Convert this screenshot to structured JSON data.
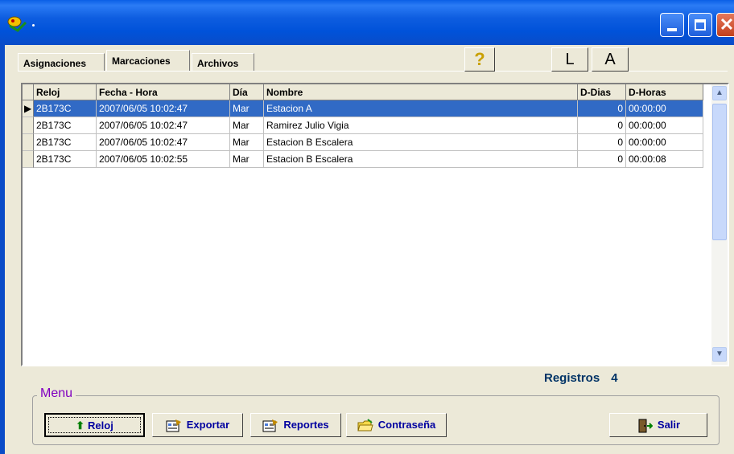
{
  "window": {
    "title": ""
  },
  "tabs": [
    {
      "label": "Asignaciones",
      "active": false
    },
    {
      "label": "Marcaciones",
      "active": true
    },
    {
      "label": "Archivos",
      "active": false
    }
  ],
  "toolbar": {
    "help_icon": "question-icon",
    "l_label": "L",
    "a_label": "A"
  },
  "grid": {
    "columns": [
      "Reloj",
      "Fecha - Hora",
      "Día",
      "Nombre",
      "D-Dias",
      "D-Horas"
    ],
    "rows": [
      {
        "reloj": "2B173C",
        "fecha": "2007/06/05 10:02:47",
        "dia": "Mar",
        "nombre": "Estacion A",
        "ddias": "0",
        "dhoras": "00:00:00"
      },
      {
        "reloj": "2B173C",
        "fecha": "2007/06/05 10:02:47",
        "dia": "Mar",
        "nombre": "Ramirez Julio Vigia",
        "ddias": "0",
        "dhoras": "00:00:00"
      },
      {
        "reloj": "2B173C",
        "fecha": "2007/06/05 10:02:47",
        "dia": "Mar",
        "nombre": "Estacion B Escalera",
        "ddias": "0",
        "dhoras": "00:00:00"
      },
      {
        "reloj": "2B173C",
        "fecha": "2007/06/05 10:02:55",
        "dia": "Mar",
        "nombre": "Estacion B Escalera",
        "ddias": "0",
        "dhoras": "00:00:08"
      }
    ],
    "selected_row": 0
  },
  "status": {
    "registros_label": "Registros",
    "registros_count": "4"
  },
  "menu": {
    "legend": "Menu",
    "buttons": {
      "reloj": "Reloj",
      "exportar": "Exportar",
      "reportes": "Reportes",
      "contrasena": "Contraseña",
      "salir": "Salir"
    }
  },
  "colors": {
    "selection": "#316ac5",
    "title_bar": "#0a4cc8",
    "menu_text": "#8000c0",
    "button_text": "#0000a0"
  }
}
